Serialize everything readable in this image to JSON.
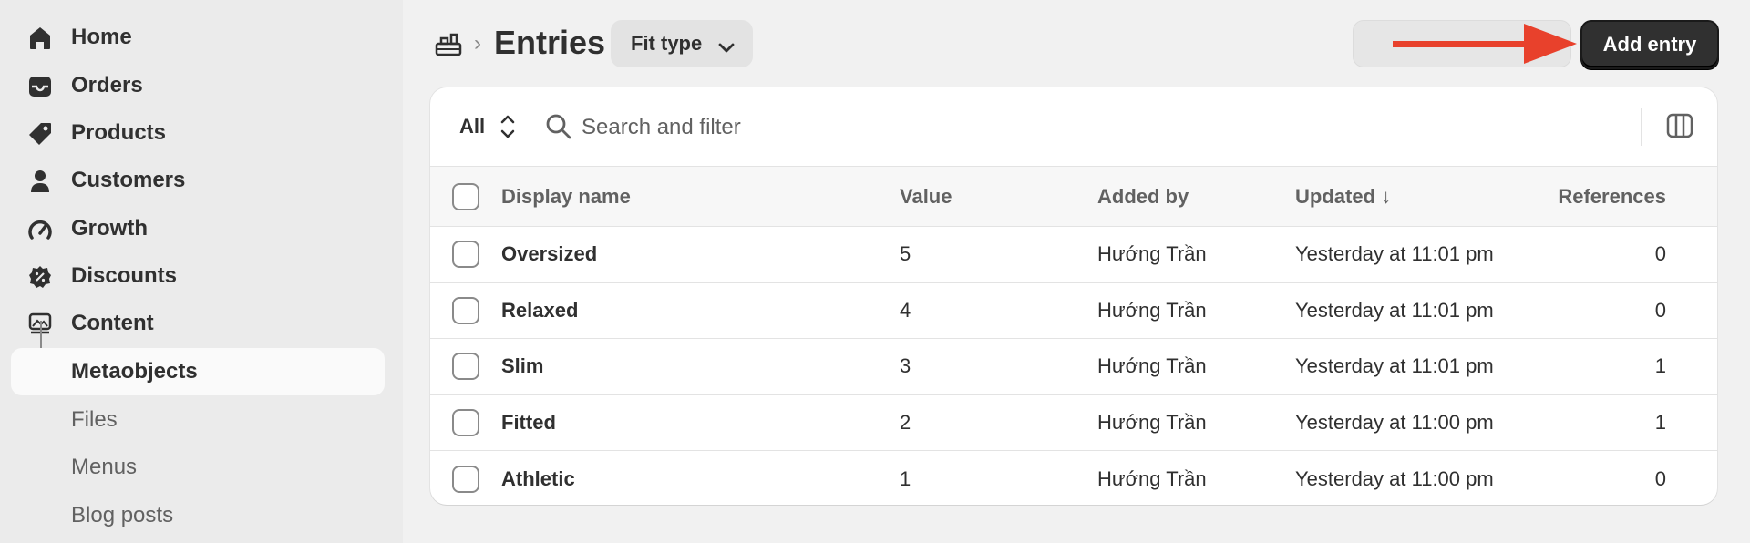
{
  "sidebar": {
    "items": [
      {
        "label": "Home",
        "icon": "home-icon"
      },
      {
        "label": "Orders",
        "icon": "orders-icon"
      },
      {
        "label": "Products",
        "icon": "tag-icon"
      },
      {
        "label": "Customers",
        "icon": "person-icon"
      },
      {
        "label": "Growth",
        "icon": "gauge-icon"
      },
      {
        "label": "Discounts",
        "icon": "discount-icon"
      },
      {
        "label": "Content",
        "icon": "content-icon"
      }
    ],
    "sub_items": [
      {
        "label": "Metaobjects",
        "active": true
      },
      {
        "label": "Files",
        "active": false
      },
      {
        "label": "Menus",
        "active": false
      },
      {
        "label": "Blog posts",
        "active": false
      }
    ]
  },
  "header": {
    "breadcrumb_separator": "›",
    "title": "Entries",
    "filter_button": "Fit type",
    "add_button": "Add entry",
    "arrow_color": "#e8412c"
  },
  "toolbar": {
    "tab_all": "All",
    "search_placeholder": "Search and filter"
  },
  "table": {
    "columns": [
      "Display name",
      "Value",
      "Added by",
      "Updated ↓",
      "References"
    ],
    "rows": [
      {
        "name": "Oversized",
        "value": "5",
        "added_by": "Hướng Trần",
        "updated": "Yesterday at 11:01 pm",
        "refs": "0"
      },
      {
        "name": "Relaxed",
        "value": "4",
        "added_by": "Hướng Trần",
        "updated": "Yesterday at 11:01 pm",
        "refs": "0"
      },
      {
        "name": "Slim",
        "value": "3",
        "added_by": "Hướng Trần",
        "updated": "Yesterday at 11:01 pm",
        "refs": "1"
      },
      {
        "name": "Fitted",
        "value": "2",
        "added_by": "Hướng Trần",
        "updated": "Yesterday at 11:00 pm",
        "refs": "1"
      },
      {
        "name": "Athletic",
        "value": "1",
        "added_by": "Hướng Trần",
        "updated": "Yesterday at 11:00 pm",
        "refs": "0"
      }
    ]
  }
}
